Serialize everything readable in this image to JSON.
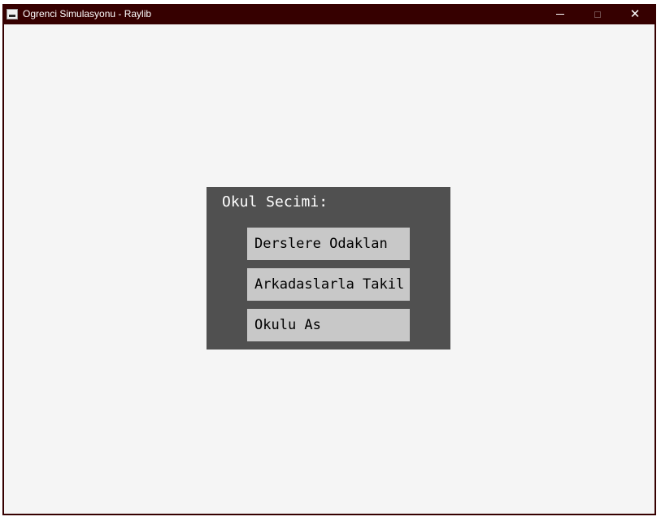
{
  "window": {
    "title": "Ogrenci Simulasyonu - Raylib",
    "icon": "raylib-app-icon",
    "controls": {
      "minimize": "minimize-icon",
      "maximize": "maximize-icon",
      "close_glyph": "✕"
    },
    "titlebar_color": "#360000"
  },
  "canvas": {
    "background": "#f5f5f5"
  },
  "menu": {
    "title": "Okul Secimi:",
    "panel_color": "#505050",
    "button_color": "#c8c8c8",
    "options": [
      "Derslere Odaklan",
      "Arkadaslarla Takil",
      "Okulu As"
    ]
  }
}
